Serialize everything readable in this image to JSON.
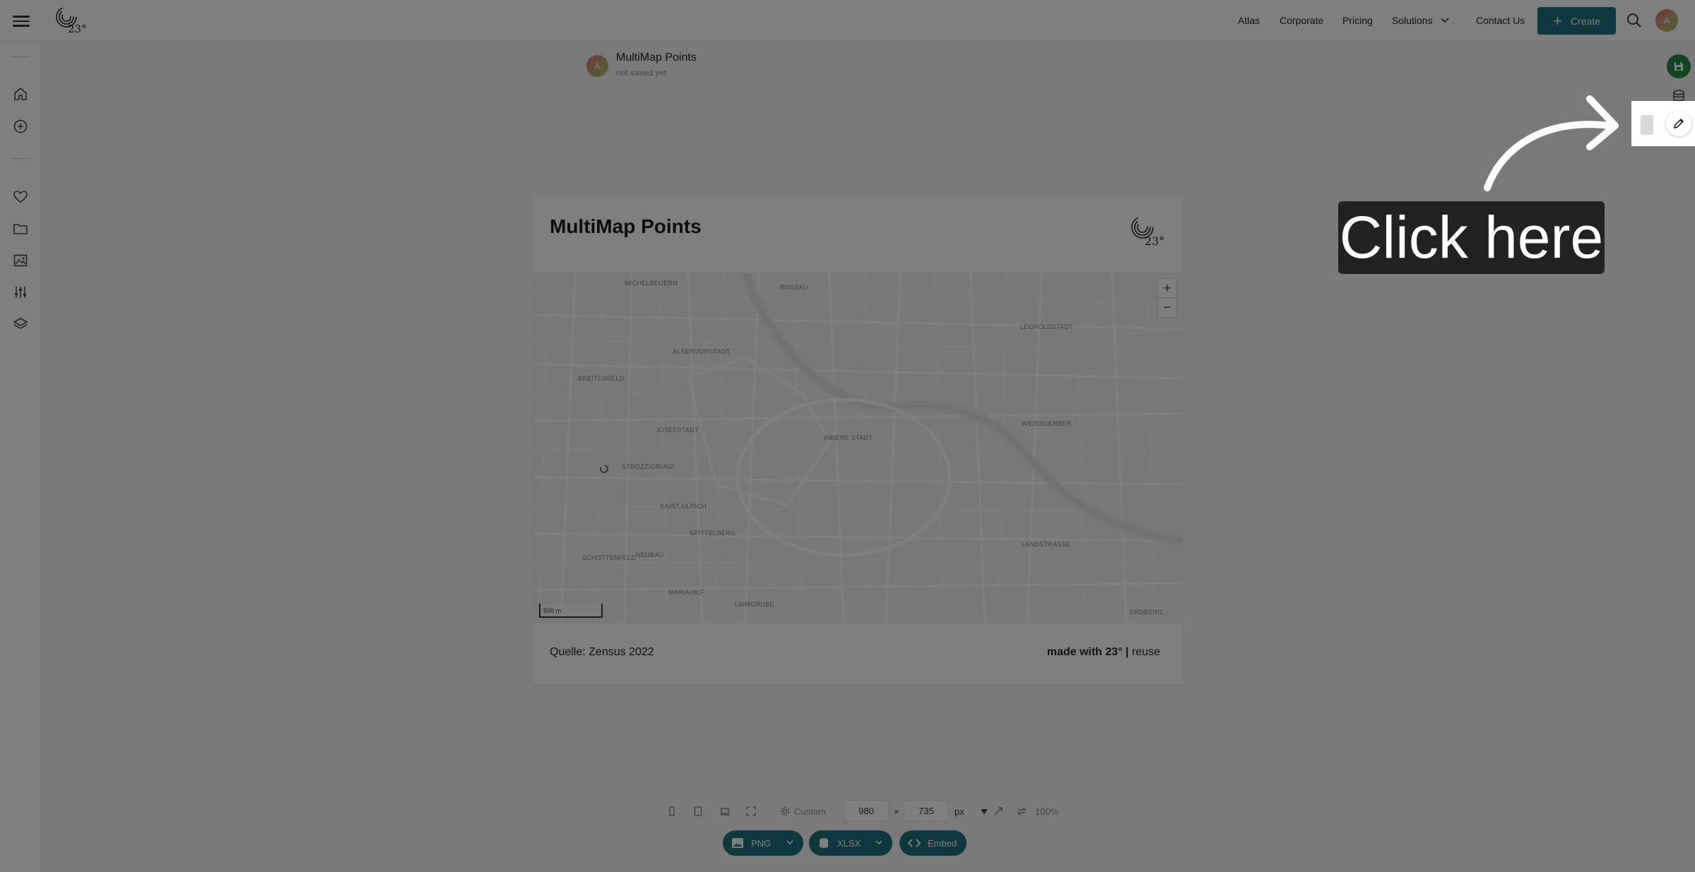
{
  "header": {
    "nav": [
      "Atlas",
      "Corporate",
      "Pricing",
      "Solutions",
      "Contact Us"
    ],
    "create_label": "Create",
    "avatar_initial": "A"
  },
  "logo_text": "23°",
  "document": {
    "title": "MultiMap Points",
    "subtitle": "not saved yet",
    "avatar_initial": "A"
  },
  "card": {
    "title": "MultiMap Points",
    "source": "Quelle: Zensus 2022",
    "made_with": "made with 23° |",
    "reuse": "reuse"
  },
  "map": {
    "districts": [
      "MICHELBEUERN",
      "ROSSAU",
      "LEOPOLDSTADT",
      "ALSERVORSTADT",
      "BREITENFELD",
      "JOSEFSTADT",
      "INNERE STADT",
      "WEISSGERBER",
      "STROZZIGRUND",
      "SAINT ULRICH",
      "SPITTELBERG",
      "SCHOTTENFELD",
      "NEUBAU",
      "LANDSTRASSE",
      "MARIAHILF",
      "LAIMGRUBE",
      "ERDBERG"
    ],
    "zoom_in": "+",
    "zoom_out": "−",
    "scale": "500 m"
  },
  "toolbar": {
    "preset": "Custom",
    "width": "980",
    "times": "×",
    "height": "735",
    "unit": "px",
    "zoom": "100%"
  },
  "export": {
    "png": "PNG",
    "xlsx": "XLSX",
    "embed": "Embed"
  },
  "tutorial": {
    "callout": "Click here"
  }
}
